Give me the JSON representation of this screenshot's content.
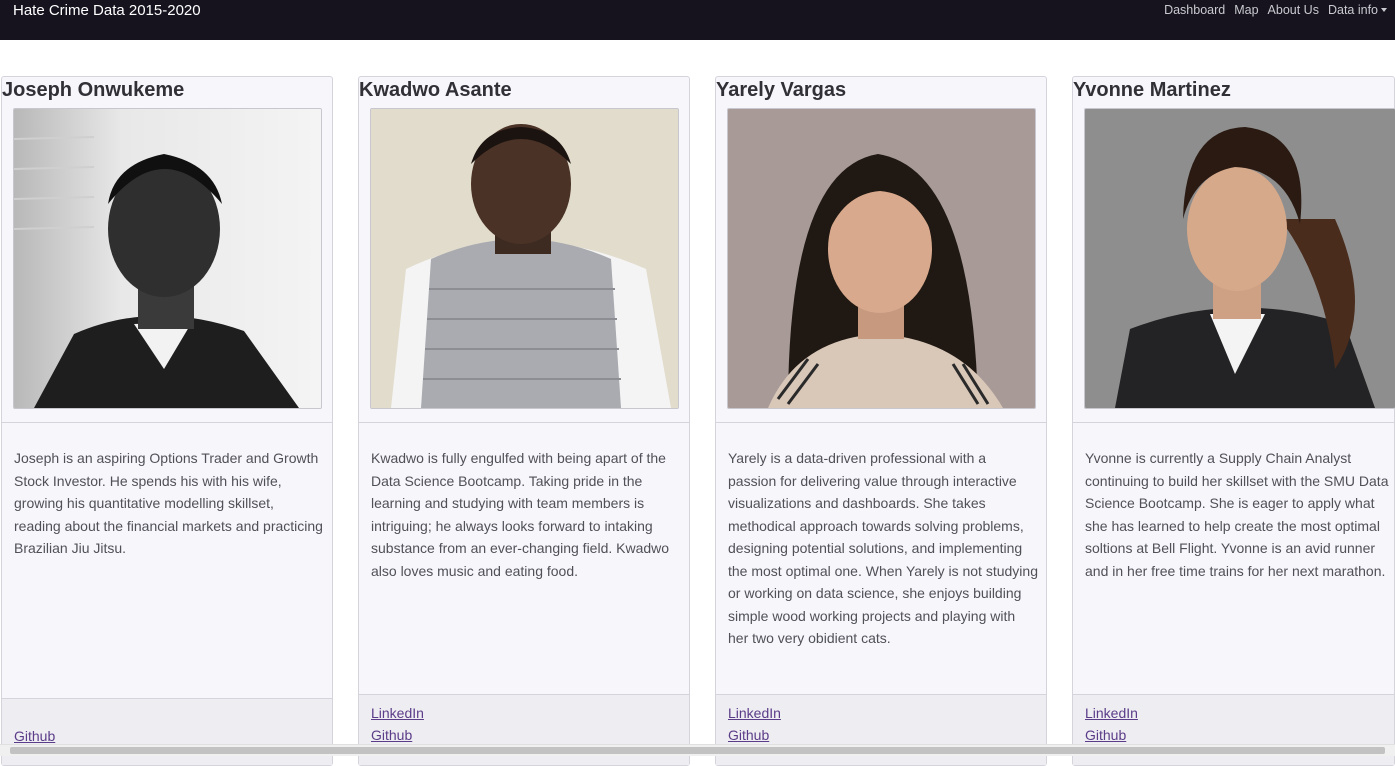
{
  "navbar": {
    "brand": "Hate Crime Data 2015-2020",
    "links": [
      "Dashboard",
      "Map",
      "About Us"
    ],
    "dropdown_label": "Data info"
  },
  "members": [
    {
      "name": "Joseph Onwukeme",
      "bio": "Joseph is an aspiring Options Trader and Growth Stock Investor. He spends his with his wife, growing his quantitative modelling skillset, reading about the financial markets and practicing Brazilian Jiu Jitsu.",
      "links": [
        "Github"
      ]
    },
    {
      "name": "Kwadwo Asante",
      "bio": "Kwadwo is fully engulfed with being apart of the Data Science Bootcamp. Taking pride in the learning and studying with team members is intriguing; he always looks forward to intaking substance from an ever-changing field. Kwadwo also loves music and eating food.",
      "links": [
        "LinkedIn",
        "Github"
      ]
    },
    {
      "name": "Yarely Vargas",
      "bio": "Yarely is a data-driven professional with a passion for delivering value through interactive visualizations and dashboards. She takes methodical approach towards solving problems, designing potential solutions, and implementing the most optimal one. When Yarely is not studying or working on data science, she enjoys building simple wood working projects and playing with her two very obidient cats.",
      "links": [
        "LinkedIn",
        "Github"
      ]
    },
    {
      "name": "Yvonne Martinez",
      "bio": "Yvonne is currently a Supply Chain Analyst continuing to build her skillset with the SMU Data Science Bootcamp. She is eager to apply what she has learned to help create the most optimal soltions at Bell Flight. Yvonne is an avid runner and in her free time trains for her next marathon.",
      "links": [
        "LinkedIn",
        "Github"
      ]
    }
  ],
  "colors": {
    "navbar_bg": "#16131f",
    "link": "#5b3c88",
    "card_bg": "#f7f6fb"
  }
}
